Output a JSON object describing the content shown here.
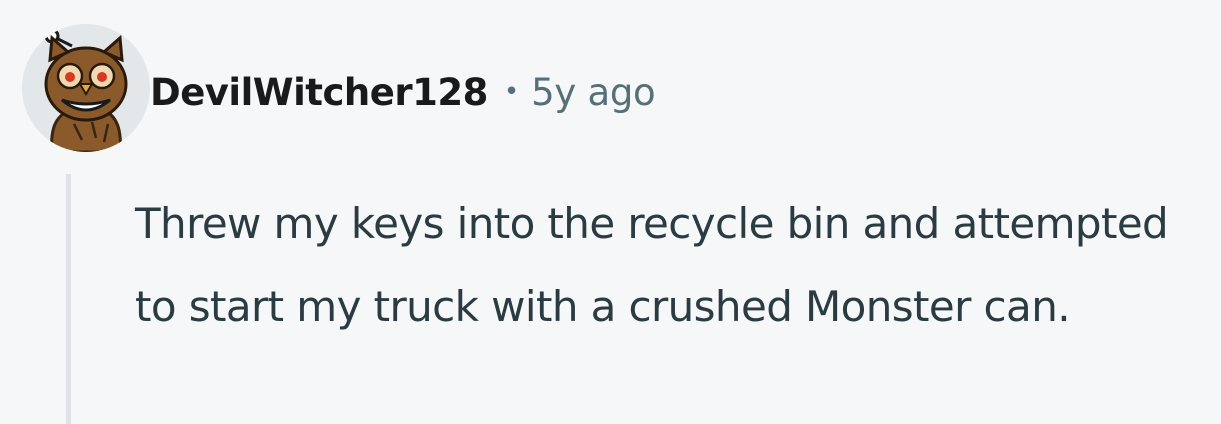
{
  "comment": {
    "author": "DevilWitcher128",
    "separator": "•",
    "timestamp": "5y ago",
    "avatar_icon": "snoo-owl-costume-avatar",
    "body": "Threw my keys into the recycle bin and attempted to start my truck with a crushed Monster can."
  },
  "colors": {
    "background": "#f6f7f8",
    "author_text": "#1a1a1b",
    "meta_text": "#576f76",
    "body_text": "#2a3c42",
    "thread_line": "#dde3e6"
  }
}
